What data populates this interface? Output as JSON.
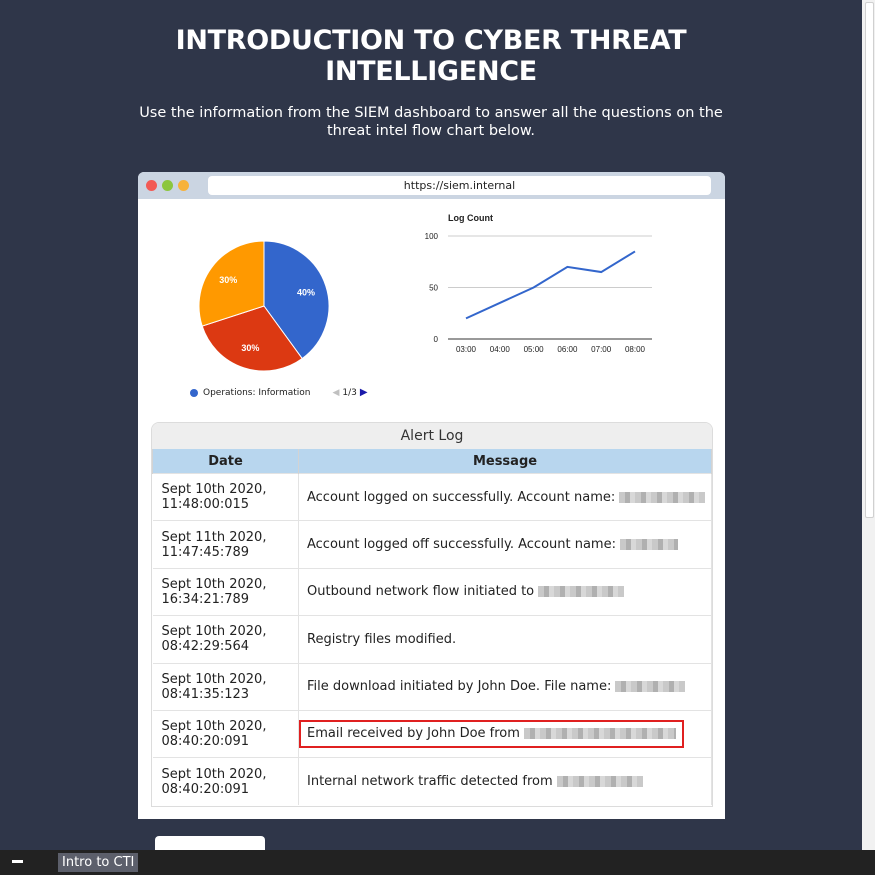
{
  "header": {
    "title_line1": "INTRODUCTION TO CYBER THREAT",
    "title_line2": "INTELLIGENCE",
    "subtitle_line1": "Use the information from the SIEM dashboard to answer all the questions on the",
    "subtitle_line2": "threat intel flow chart below."
  },
  "browser": {
    "url": "https://siem.internal"
  },
  "charts": {
    "chart_data": [
      {
        "type": "pie",
        "slices": [
          {
            "label": "40%",
            "value": 40,
            "color": "#3366cc"
          },
          {
            "label": "30%",
            "value": 30,
            "color": "#dc3912"
          },
          {
            "label": "30%",
            "value": 30,
            "color": "#ff9900"
          }
        ],
        "legend": {
          "entry": "Operations: Information",
          "page": "1/3"
        }
      },
      {
        "type": "line",
        "title": "Log Count",
        "x": [
          "03:00",
          "04:00",
          "05:00",
          "06:00",
          "07:00",
          "08:00"
        ],
        "values": [
          20,
          35,
          50,
          70,
          65,
          85
        ],
        "yticks": [
          "0",
          "50",
          "100"
        ],
        "ylim": [
          0,
          100
        ],
        "color": "#3366cc"
      }
    ]
  },
  "alert_log": {
    "title": "Alert Log",
    "headers": {
      "date": "Date",
      "message": "Message"
    },
    "rows": [
      {
        "date1": "Sept 10th 2020,",
        "date2": "11:48:00:015",
        "message": "Account logged on successfully. Account name:"
      },
      {
        "date1": "Sept 11th 2020,",
        "date2": "11:47:45:789",
        "message": "Account logged off successfully. Account name:"
      },
      {
        "date1": "Sept 10th 2020,",
        "date2": "16:34:21:789",
        "message": "Outbound network flow initiated to"
      },
      {
        "date1": "Sept 10th 2020,",
        "date2": "08:42:29:564",
        "message": "Registry files modified."
      },
      {
        "date1": "Sept 10th 2020,",
        "date2": "08:41:35:123",
        "message": "File download initiated by John Doe. File name:"
      },
      {
        "date1": "Sept 10th 2020,",
        "date2": "08:40:20:091",
        "message": "Email received by John Doe from"
      },
      {
        "date1": "Sept 10th 2020,",
        "date2": "08:40:20:091",
        "message": "Internal network traffic detected from"
      }
    ]
  },
  "taskbar": {
    "tab_label": "Intro to CTI"
  }
}
